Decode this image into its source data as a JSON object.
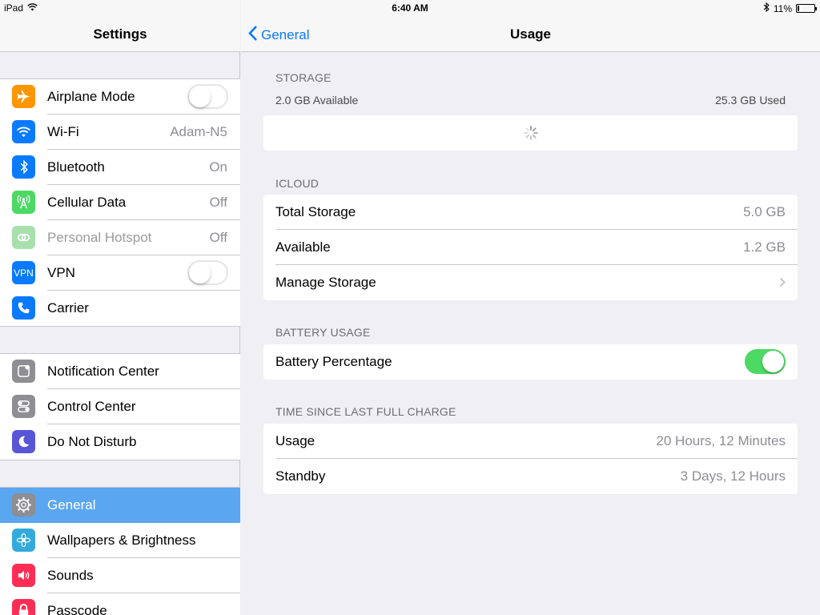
{
  "status_bar": {
    "device": "iPad",
    "time": "6:40 AM",
    "battery_percent_label": "11%",
    "battery_level": 0.11
  },
  "sidebar": {
    "title": "Settings",
    "groups": [
      {
        "items": [
          {
            "label": "Airplane Mode",
            "icon": "airplane-icon",
            "color": "#ff9500",
            "control": "toggle",
            "on": false
          },
          {
            "label": "Wi-Fi",
            "icon": "wifi-icon",
            "color": "#0a7aff",
            "value": "Adam-N5"
          },
          {
            "label": "Bluetooth",
            "icon": "bluetooth-icon",
            "color": "#0a7aff",
            "value": "On"
          },
          {
            "label": "Cellular Data",
            "icon": "cellular-icon",
            "color": "#4cd964",
            "value": "Off"
          },
          {
            "label": "Personal Hotspot",
            "icon": "hotspot-icon",
            "color": "#a8e0ad",
            "value": "Off",
            "disabled": true
          },
          {
            "label": "VPN",
            "icon": "vpn-icon",
            "icon_text": "VPN",
            "color": "#0a7aff",
            "control": "toggle",
            "on": false
          },
          {
            "label": "Carrier",
            "icon": "phone-icon",
            "color": "#0a7aff"
          }
        ]
      },
      {
        "items": [
          {
            "label": "Notification Center",
            "icon": "notification-center-icon",
            "color": "#8e8e93"
          },
          {
            "label": "Control Center",
            "icon": "control-center-icon",
            "color": "#8e8e93"
          },
          {
            "label": "Do Not Disturb",
            "icon": "moon-icon",
            "color": "#5856d6"
          }
        ]
      },
      {
        "items": [
          {
            "label": "General",
            "icon": "gear-icon",
            "color": "#8e8e93",
            "selected": true
          },
          {
            "label": "Wallpapers & Brightness",
            "icon": "flower-icon",
            "color": "#34aadc"
          },
          {
            "label": "Sounds",
            "icon": "speaker-icon",
            "color": "#ff2d55"
          },
          {
            "label": "Passcode",
            "icon": "lock-icon",
            "color": "#ff2d55"
          }
        ]
      }
    ]
  },
  "detail": {
    "back_label": "General",
    "title": "Usage",
    "storage": {
      "header": "STORAGE",
      "available": "2.0 GB Available",
      "used": "25.3 GB Used"
    },
    "icloud": {
      "header": "ICLOUD",
      "rows": [
        {
          "label": "Total Storage",
          "value": "5.0 GB"
        },
        {
          "label": "Available",
          "value": "1.2 GB"
        },
        {
          "label": "Manage Storage",
          "value": ""
        }
      ]
    },
    "battery_usage": {
      "header": "BATTERY USAGE",
      "label": "Battery Percentage",
      "on": true
    },
    "last_charge": {
      "header": "TIME SINCE LAST FULL CHARGE",
      "rows": [
        {
          "label": "Usage",
          "value": "20 Hours, 12 Minutes"
        },
        {
          "label": "Standby",
          "value": "3 Days, 12 Hours"
        }
      ]
    }
  }
}
